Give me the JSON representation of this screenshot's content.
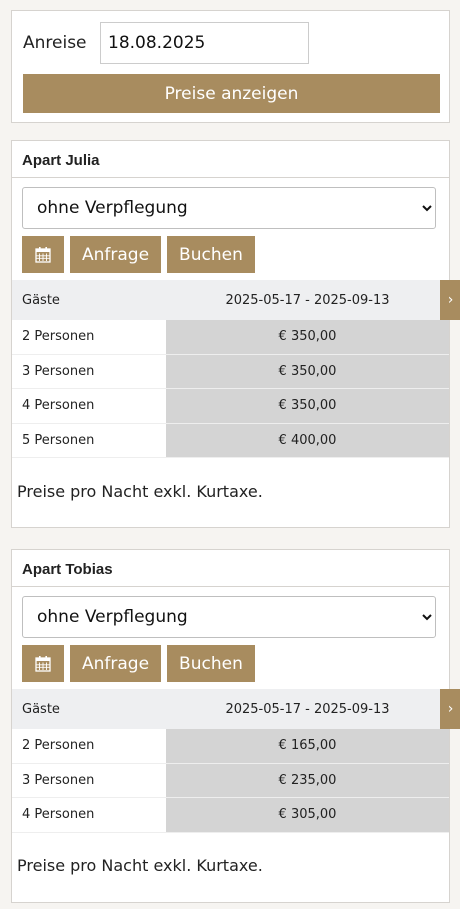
{
  "search": {
    "label": "Anreise",
    "date_value": "18.08.2025",
    "submit_label": "Preise anzeigen"
  },
  "apartments": [
    {
      "title": "Apart Julia",
      "board": "ohne Verpflegung",
      "buttons": {
        "calendar_icon": "calendar-icon",
        "inquiry": "Anfrage",
        "book": "Buchen"
      },
      "table": {
        "header_guests": "Gäste",
        "header_period": "2025-05-17 - 2025-09-13",
        "next_icon": "›",
        "rows": [
          {
            "guests": "2 Personen",
            "price": "€ 350,00"
          },
          {
            "guests": "3 Personen",
            "price": "€ 350,00"
          },
          {
            "guests": "4 Personen",
            "price": "€ 350,00"
          },
          {
            "guests": "5 Personen",
            "price": "€ 400,00"
          }
        ]
      },
      "note": "Preise pro Nacht exkl. Kurtaxe."
    },
    {
      "title": "Apart Tobias",
      "board": "ohne Verpflegung",
      "buttons": {
        "calendar_icon": "calendar-icon",
        "inquiry": "Anfrage",
        "book": "Buchen"
      },
      "table": {
        "header_guests": "Gäste",
        "header_period": "2025-05-17 - 2025-09-13",
        "next_icon": "›",
        "rows": [
          {
            "guests": "2 Personen",
            "price": "€ 165,00"
          },
          {
            "guests": "3 Personen",
            "price": "€ 235,00"
          },
          {
            "guests": "4 Personen",
            "price": "€ 305,00"
          }
        ]
      },
      "note": "Preise pro Nacht exkl. Kurtaxe."
    }
  ],
  "colors": {
    "accent": "#a88c5f",
    "price_cell": "#d4d4d4",
    "header_bg": "#eeeff1",
    "page_bg": "#f6f4f1"
  }
}
